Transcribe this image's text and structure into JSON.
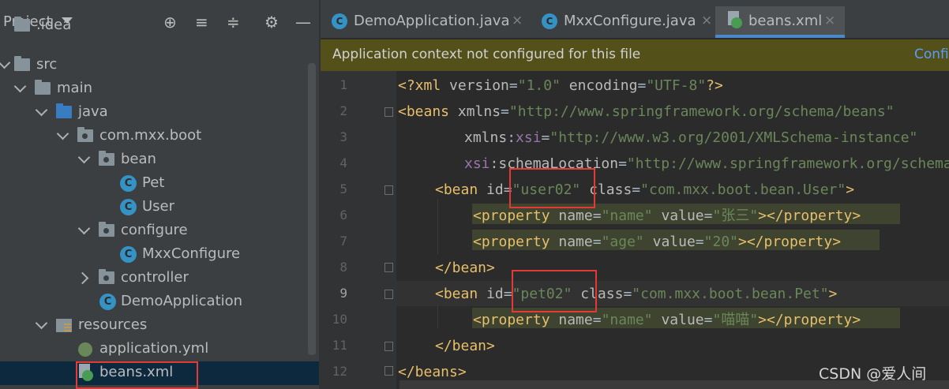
{
  "project_panel": {
    "title": "Project",
    "header_icons": [
      "locate-icon",
      "expand-all-icon",
      "collapse-all-icon",
      "settings-icon",
      "minimize-icon"
    ],
    "tree": [
      {
        "label": ".idea",
        "icon": "folder-icon",
        "expanded": false
      },
      {
        "label": "src",
        "icon": "folder-icon",
        "expanded": true
      },
      {
        "label": "main",
        "icon": "folder-icon",
        "expanded": true
      },
      {
        "label": "java",
        "icon": "source-folder-icon",
        "expanded": true
      },
      {
        "label": "com.mxx.boot",
        "icon": "package-icon",
        "expanded": true
      },
      {
        "label": "bean",
        "icon": "package-icon",
        "expanded": true
      },
      {
        "label": "Pet",
        "icon": "class-icon"
      },
      {
        "label": "User",
        "icon": "class-icon"
      },
      {
        "label": "configure",
        "icon": "package-icon",
        "expanded": true
      },
      {
        "label": "MxxConfigure",
        "icon": "class-icon"
      },
      {
        "label": "controller",
        "icon": "package-icon",
        "expanded": false
      },
      {
        "label": "DemoApplication",
        "icon": "spring-boot-class-icon"
      },
      {
        "label": "resources",
        "icon": "resources-folder-icon",
        "expanded": true
      },
      {
        "label": "application.yml",
        "icon": "yaml-config-icon"
      },
      {
        "label": "beans.xml",
        "icon": "spring-xml-icon",
        "selected": true
      }
    ]
  },
  "tabs": [
    {
      "label": "DemoApplication.java",
      "icon": "class-icon",
      "close": "×"
    },
    {
      "label": "MxxConfigure.java",
      "icon": "class-icon",
      "close": "×"
    },
    {
      "label": "beans.xml",
      "icon": "spring-xml-icon",
      "close": "×",
      "active": true
    }
  ],
  "banner": {
    "text": "Application context not configured for this file",
    "link": "Confi"
  },
  "editor": {
    "line_numbers": [
      "1",
      "2",
      "3",
      "4",
      "5",
      "6",
      "7",
      "8",
      "9",
      "10",
      "11",
      "12"
    ],
    "current_line": "9",
    "lines": {
      "l1": {
        "a": "<?xml ",
        "b": "version",
        "c": "=",
        "d": "\"1.0\"",
        "e": " encoding",
        "f": "=",
        "g": "\"UTF-8\"",
        "h": "?>"
      },
      "l2": {
        "a": "<beans ",
        "b": "xmlns",
        "c": "=",
        "d": "\"http://www.springframework.org/schema/beans\""
      },
      "l3": {
        "a": "xmlns",
        "b": ":",
        "c": "xsi",
        "d": "=",
        "e": "\"http://www.w3.org/2001/XMLSchema-instance\""
      },
      "l4": {
        "a": "xsi",
        "b": ":",
        "c": "schemaLocation",
        "d": "=",
        "e": "\"http://www.springframework.org/schema/beans\""
      },
      "l5": {
        "a": "<bean ",
        "b": "id",
        "c": "=",
        "d": "\"user02\"",
        "e": " class",
        "f": "=",
        "g": "\"com.mxx.boot.bean.User\"",
        "h": ">"
      },
      "l6": {
        "a": "<property ",
        "b": "name",
        "c": "=",
        "d": "\"name\"",
        "e": " value",
        "f": "=",
        "g": "\"张三\"",
        "h": "></property>"
      },
      "l7": {
        "a": "<property ",
        "b": "name",
        "c": "=",
        "d": "\"age\"",
        "e": " value",
        "f": "=",
        "g": "\"20\"",
        "h": "></property>"
      },
      "l8": {
        "a": "</bean>"
      },
      "l9": {
        "a": "<bean ",
        "b": "id",
        "c": "=",
        "d": "\"pet02\"",
        "e": " class",
        "f": "=",
        "g": "\"com.mxx.boot.bean.Pet\"",
        "h": ">"
      },
      "l10": {
        "a": "<property ",
        "b": "name",
        "c": "=",
        "d": "\"name\"",
        "e": " value",
        "f": "=",
        "g": "\"喵喵\"",
        "h": "></property>"
      },
      "l11": {
        "a": "</bean>"
      },
      "l12": {
        "a": "</beans>"
      }
    }
  },
  "watermark": "CSDN @爱人间",
  "colors": {
    "panel_bg": "#3c3f41",
    "editor_bg": "#2b2b2b",
    "banner_bg": "#535119",
    "tag": "#e8bf6a",
    "attr": "#bababa",
    "namespace": "#9876aa",
    "string": "#6a8759",
    "annotation_box": "#e53935",
    "active_tab_underline": "#4a88c7"
  }
}
